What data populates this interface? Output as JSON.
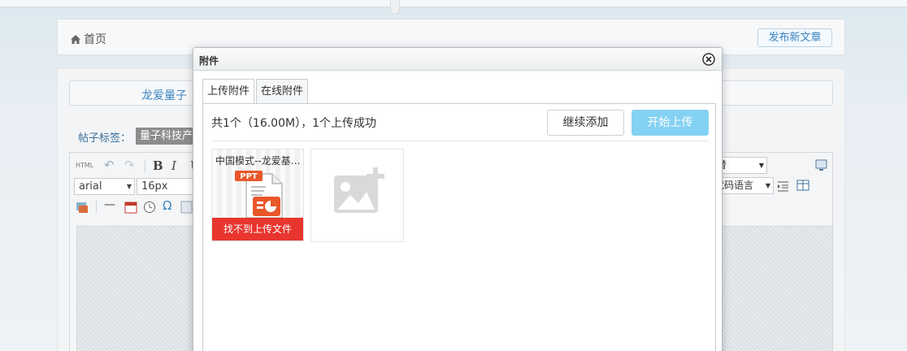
{
  "home": {
    "label": "首页",
    "publish_button": "发布新文章"
  },
  "category": {
    "active": "龙爱量子"
  },
  "tags": {
    "label": "帖子标签：",
    "chip": "量子科技产业"
  },
  "editor": {
    "html_label": "HTML",
    "bold": "B",
    "italic": "I",
    "underline": "U",
    "font_family": "arial",
    "font_size": "16px",
    "right_select_1": "替",
    "right_select_2": "代码语言",
    "omega": "Ω"
  },
  "dialog": {
    "title": "附件",
    "tabs": [
      {
        "label": "上传附件",
        "active": true
      },
      {
        "label": "在线附件",
        "active": false
      }
    ],
    "status": "共1个（16.00M），1个上传成功",
    "add_more_button": "继续添加",
    "start_upload_button": "开始上传",
    "file": {
      "name": "中国模式--龙爱基…",
      "type_badge": "PPT",
      "error": "找不到上传文件"
    }
  },
  "colors": {
    "accent_blue": "#3a85c2",
    "upload_button": "#83d1f3",
    "error_red": "#e8352e",
    "ppt_orange": "#e8572a"
  }
}
